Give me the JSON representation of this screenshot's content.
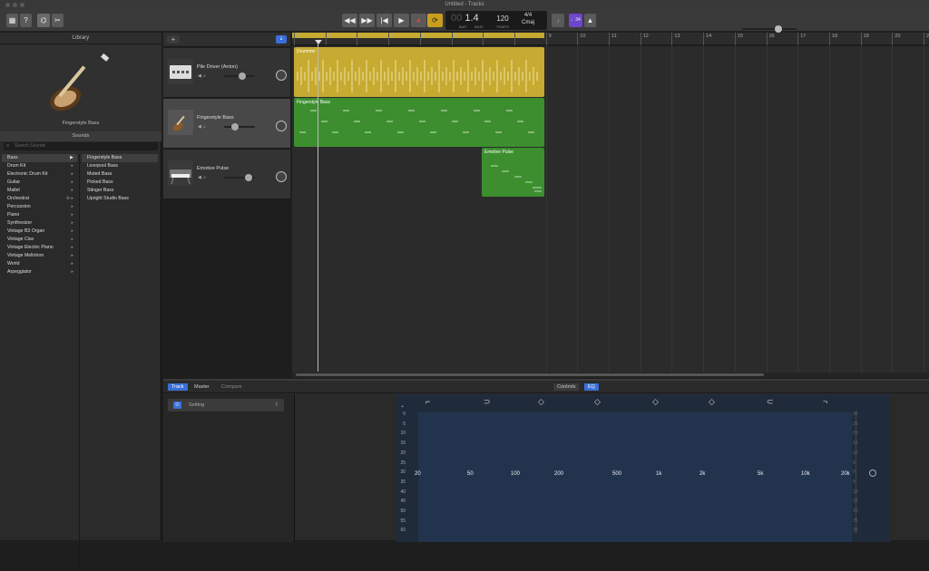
{
  "window": {
    "title": "Untitled - Tracks"
  },
  "lcd": {
    "bar": "1.4",
    "bar_prefix": "00",
    "beat_label": "BAR",
    "beat_label2": "BEAT",
    "tempo": "120",
    "tempo_label": "TEMPO",
    "sig": "4/4",
    "key": "Cmaj"
  },
  "toolbar": {
    "count_in": "♩34"
  },
  "library": {
    "title": "Library",
    "instrument": "Fingerstyle Bass",
    "sounds_header": "Sounds",
    "search_placeholder": "Search Sounds",
    "categories": [
      "Bass",
      "Drum Kit",
      "Electronic Drum Kit",
      "Guitar",
      "Mallet",
      "Orchestral",
      "Percussion",
      "Piano",
      "Synthesizer",
      "Vintage B3 Organ",
      "Vintage Clav",
      "Vintage Electric Piano",
      "Vintage Mellotron",
      "World",
      "Arpeggiator"
    ],
    "sounds": [
      "Fingerstyle Bass",
      "Liverpool Bass",
      "Muted Bass",
      "Picked Bass",
      "Stinger Bass",
      "Upright Studio Bass"
    ]
  },
  "ruler": {
    "bars": [
      "1",
      "2",
      "3",
      "4",
      "5",
      "6",
      "7",
      "8",
      "9",
      "10",
      "11",
      "12",
      "13",
      "14",
      "15",
      "16",
      "17",
      "18",
      "19",
      "20",
      "21"
    ]
  },
  "tracks": [
    {
      "name": "Pile Driver (Anton)",
      "region": "Drummer",
      "volume": 0.6
    },
    {
      "name": "Fingerstyle Bass",
      "region": "Fingerstyle Bass",
      "volume": 0.35
    },
    {
      "name": "Emotive Pulse",
      "region": "Emotive Pulse",
      "volume": 0.8
    }
  ],
  "bottom": {
    "tabs": [
      "Track",
      "Master",
      "Compare"
    ],
    "center_tabs": [
      "Controls",
      "EQ"
    ],
    "setting": "Setting",
    "power": "⏻"
  },
  "eq": {
    "y_left": [
      "0",
      "5",
      "10",
      "15",
      "20",
      "25",
      "30",
      "35",
      "40",
      "45",
      "50",
      "55",
      "60"
    ],
    "y_right": [
      "30",
      "25",
      "20",
      "15",
      "10",
      "5",
      "0",
      "5",
      "10",
      "15",
      "20",
      "25",
      "30"
    ],
    "db_plus": "+",
    "x_labels": [
      "20",
      "50",
      "100",
      "200",
      "500",
      "1k",
      "2k",
      "5k",
      "10k",
      "20k"
    ]
  },
  "colors": {
    "drummer": "#c6aa31",
    "bass": "#3c8e2e",
    "accent": "#3a6fd8",
    "count_in": "#6a48c9"
  }
}
